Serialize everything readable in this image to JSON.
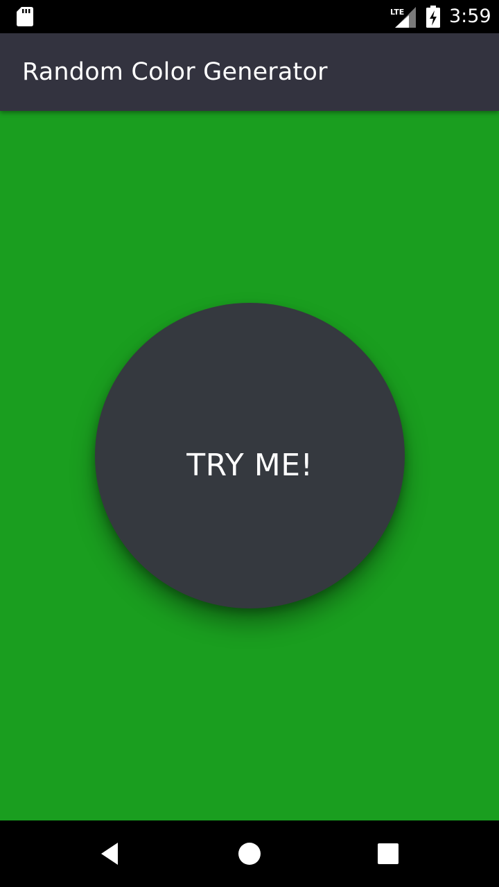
{
  "status_bar": {
    "time": "3:59",
    "network_label": "LTE",
    "icons": [
      "sd-card-icon",
      "lte-signal-icon",
      "battery-charging-icon"
    ]
  },
  "app_bar": {
    "title": "Random Color Generator",
    "color": "#33333f"
  },
  "main": {
    "background_color": "#1a9e1f",
    "button": {
      "label": "TRY ME!",
      "color": "#35393f"
    }
  },
  "nav_bar": {
    "items": [
      "back-icon",
      "home-icon",
      "recents-icon"
    ]
  }
}
